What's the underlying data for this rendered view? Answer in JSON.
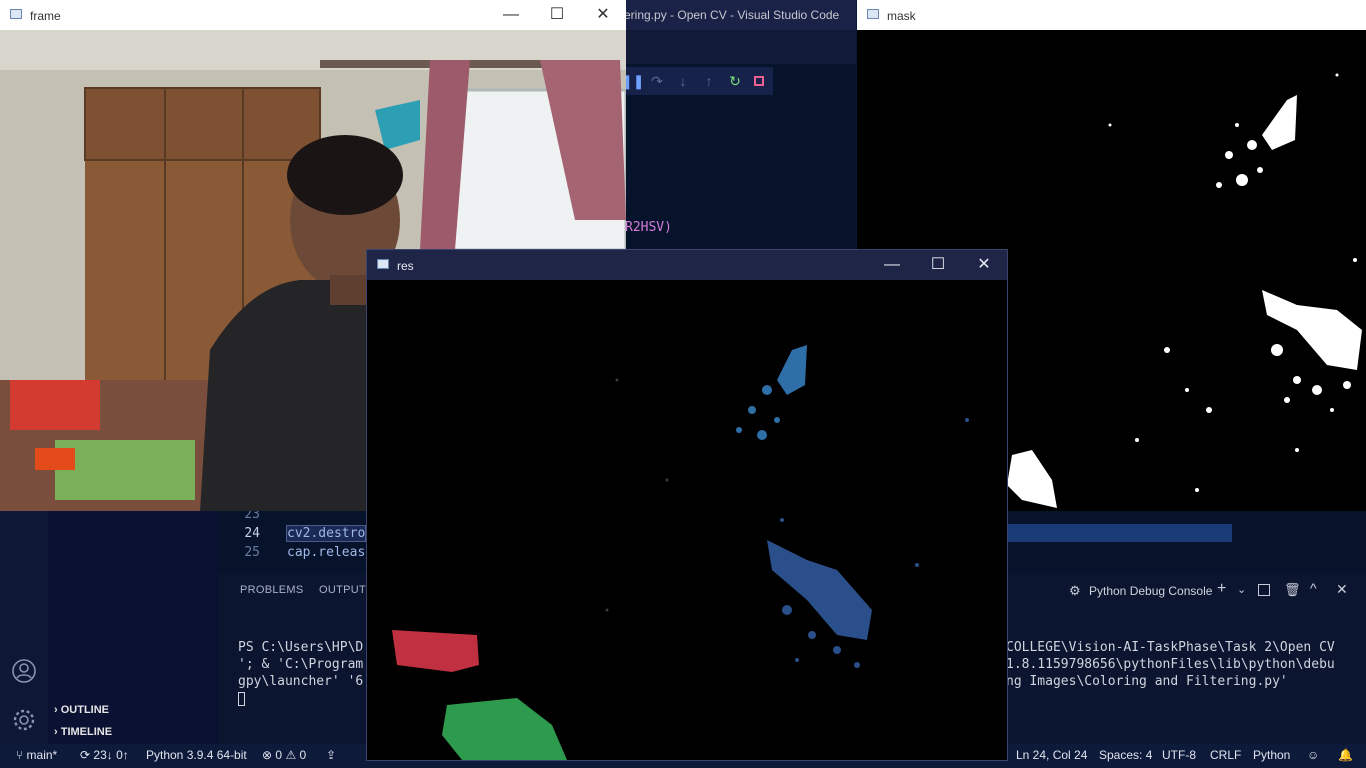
{
  "vscode": {
    "title": "ering.py - Open CV - Visual Studio Code",
    "code_fragment": "R2HSV)",
    "editor_lines": [
      {
        "no": "23",
        "code": ""
      },
      {
        "no": "24",
        "code": "cv2.destro"
      },
      {
        "no": "25",
        "code": "cap.releas"
      }
    ],
    "sidebar": {
      "outline": "OUTLINE",
      "timeline": "TIMELINE"
    },
    "panel": {
      "tabs": [
        "PROBLEMS",
        "OUTPUT"
      ],
      "console_label": "Python Debug Console",
      "terminal_left": [
        "PS C:\\Users\\HP\\D",
        "'; & 'C:\\Program",
        "gpy\\launcher' '6"
      ],
      "terminal_right": [
        "COLLEGE\\Vision-AI-TaskPhase\\Task 2\\Open CV",
        "1.8.1159798656\\pythonFiles\\lib\\python\\debu",
        "ng Images\\Coloring and Filtering.py'"
      ]
    },
    "statusbar": {
      "branch": "main*",
      "sync": "23↓ 0↑",
      "interpreter": "Python 3.9.4 64-bit",
      "errors": "0",
      "warnings": "0",
      "cursor": "Ln 24, Col 24",
      "spaces": "Spaces: 4",
      "encoding": "UTF-8",
      "eol": "CRLF",
      "language": "Python"
    }
  },
  "windows": {
    "frame": {
      "title": "frame"
    },
    "mask": {
      "title": "mask"
    },
    "res": {
      "title": "res"
    }
  },
  "colors": {
    "vscode_bg": "#0d1836",
    "statusbar_bg": "#0e1a3a",
    "res_title_bg": "#1e2547"
  }
}
